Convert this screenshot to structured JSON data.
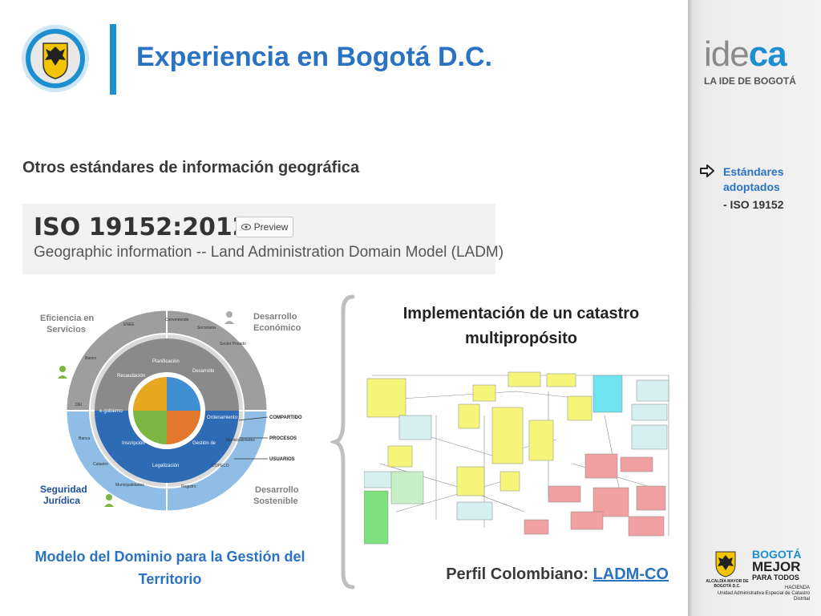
{
  "header": {
    "title": "Experiencia en Bogotá D.C."
  },
  "main": {
    "subtitle": "Otros estándares de información geográfica",
    "iso": {
      "code": "ISO 19152:2012",
      "preview_label": "Preview",
      "preview_icon": "eye-icon",
      "description": "Geographic information -- Land Administration Domain Model (LADM)"
    },
    "wheel": {
      "quadrants": [
        "Eficiencia en Servicios",
        "Desarrollo Económico",
        "Seguridad Jurídica",
        "Desarrollo Sostenible"
      ],
      "outer_ring": [
        "Conveniendo",
        "Secretaría de Desarrollo",
        "FHIS",
        "Sector Privado",
        "SAG",
        "Bancos Academia",
        "SERNA",
        "Municipalidades",
        "COPECO",
        "Registro",
        "Profesional Certificado",
        "Municipalidades",
        "Catastro",
        "Banca",
        "DEI",
        "Banco",
        "Municipalidades",
        "SANAA",
        "ENEE",
        "INSEP"
      ],
      "middle_ring": [
        "Planificación",
        "Desarrollo Socioeconómico",
        "Ordenamiento Territorial",
        "Gestión de Riesgos",
        "Legalización",
        "Inscripción Registral",
        "e-gobierno",
        "Recaudación"
      ],
      "center": [
        "Catastro",
        "Derecho",
        "Objeto",
        "Personas"
      ],
      "side_labels": [
        "COMPARTIDO",
        "PROCESOS",
        "USUARIOS"
      ]
    },
    "caption_left": "Modelo del Dominio para la Gestión del Territorio",
    "implementation_title": "Implementación de un catastro multipropósito",
    "profile_prefix": "Perfil Colombiano:",
    "profile_link": "LADM-CO"
  },
  "sidebar": {
    "brand_ide": "ide",
    "brand_ca": "ca",
    "brand_tagline": "LA IDE DE BOGOTÁ",
    "bullet_icon": "arrow-right-icon",
    "standards_label": "Estándares adoptados",
    "standards_item": "- ISO 19152",
    "logo": {
      "line1": "BOGOTÁ",
      "line2": "MEJOR",
      "line3": "PARA TODOS",
      "alcaldia": "ALCALDÍA MAYOR DE BOGOTÁ D.C.",
      "hacienda": "HACIENDA",
      "unidad": "Unidad Administrativa Especial de Catastro Distrital"
    }
  },
  "colors": {
    "accent_blue": "#2a73c2",
    "brand_blue": "#1c8fd0",
    "sidebar_gray": "#ececec"
  }
}
